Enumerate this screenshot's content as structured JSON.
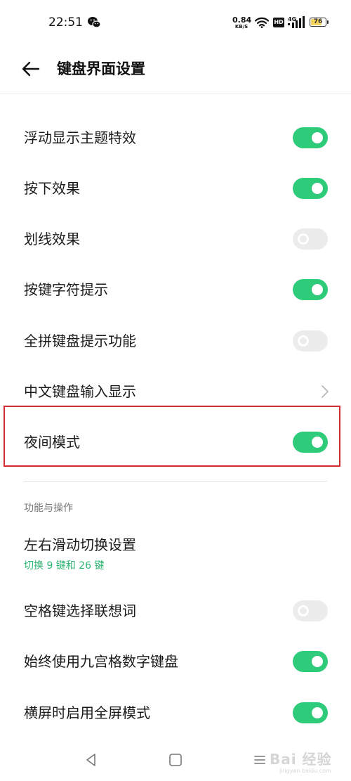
{
  "status_bar": {
    "time": "22:51",
    "net_speed_value": "0.84",
    "net_speed_unit": "KB/S",
    "hd_badge": "HD",
    "signal_label": "4G",
    "battery": "76",
    "battery_level": 0.76,
    "icons": [
      "wechat-icon",
      "wifi-icon",
      "signal-icon",
      "battery-icon"
    ]
  },
  "header": {
    "title": "键盘界面设置",
    "back_icon": "arrow-left-icon"
  },
  "colors": {
    "accent": "#2ecb7a",
    "highlight_border": "#d52a31",
    "subtitle_green": "#2eb673"
  },
  "settings": [
    {
      "label": "浮动显示主题特效",
      "type": "toggle",
      "on": true
    },
    {
      "label": "按下效果",
      "type": "toggle",
      "on": true
    },
    {
      "label": "划线效果",
      "type": "toggle",
      "on": false
    },
    {
      "label": "按键字符提示",
      "type": "toggle",
      "on": true
    },
    {
      "label": "全拼键盘提示功能",
      "type": "toggle",
      "on": false
    },
    {
      "label": "中文键盘输入显示",
      "type": "link"
    },
    {
      "label": "夜间模式",
      "type": "toggle",
      "on": true
    }
  ],
  "section2": {
    "title": "功能与操作",
    "swipe": {
      "label": "左右滑动切换设置",
      "sub": "切换 9 键和 26 键"
    },
    "items": [
      {
        "label": "空格键选择联想词",
        "type": "toggle",
        "on": false
      },
      {
        "label": "始终使用九宫格数字键盘",
        "type": "toggle",
        "on": true
      },
      {
        "label": "横屏时启用全屏模式",
        "type": "toggle",
        "on": true
      }
    ]
  },
  "nav": {
    "icons": [
      "nav-back-icon",
      "nav-home-icon",
      "nav-menu-icon"
    ]
  },
  "watermark": {
    "text": "Bai 经验",
    "sub": "jingyan.baidu.com"
  }
}
